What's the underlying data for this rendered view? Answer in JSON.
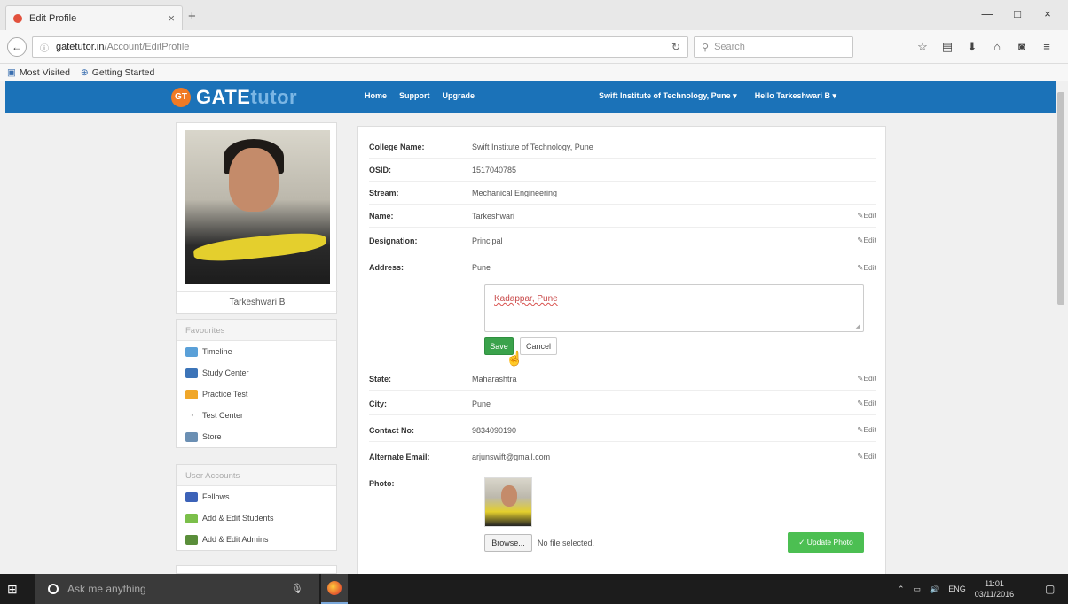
{
  "browser": {
    "tab_title": "Edit Profile",
    "tab_close": "×",
    "new_tab": "+",
    "win_minimize": "—",
    "win_restore": "□",
    "win_close": "×",
    "back": "←",
    "url_host": "gatetutor.in",
    "url_path": "/Account/EditProfile",
    "search_placeholder": "Search",
    "bookmark_1": "Most Visited",
    "bookmark_2": "Getting Started",
    "toolbar_icons": [
      "star-icon",
      "reading-list-icon",
      "download-icon",
      "home-icon",
      "pocket-icon",
      "menu-icon"
    ]
  },
  "site": {
    "logo_badge": "GT",
    "logo_text_1": "GATE",
    "logo_text_2": "tutor",
    "nav": [
      "Home",
      "Support",
      "Upgrade"
    ],
    "college_menu": "Swift Institute of Technology, Pune ▾",
    "user_menu": "Hello Tarkeshwari B ▾",
    "brand_color": "#1b72b8"
  },
  "sidebar": {
    "profile_name": "Tarkeshwari B",
    "favourites_title": "Favourites",
    "favourites": [
      "Timeline",
      "Study Center",
      "Practice Test",
      "Test Center",
      "Store"
    ],
    "accounts_title": "User Accounts",
    "accounts": [
      "Fellows",
      "Add & Edit Students",
      "Add & Edit Admins"
    ]
  },
  "profile": {
    "rows": [
      {
        "label": "College Name:",
        "value": "Swift Institute of Technology, Pune",
        "edit": ""
      },
      {
        "label": "OSID:",
        "value": "1517040785",
        "edit": ""
      },
      {
        "label": "Stream:",
        "value": "Mechanical Engineering",
        "edit": ""
      },
      {
        "label": "Name:",
        "value": "Tarkeshwari",
        "edit": "✎Edit"
      },
      {
        "label": "Designation:",
        "value": "Principal",
        "edit": "✎Edit"
      },
      {
        "label": "Address:",
        "value": "Pune",
        "edit": "✎Edit"
      },
      {
        "label": "State:",
        "value": "Maharashtra",
        "edit": "✎Edit"
      },
      {
        "label": "City:",
        "value": "Pune",
        "edit": "✎Edit"
      },
      {
        "label": "Contact No:",
        "value": "9834090190",
        "edit": "✎Edit"
      },
      {
        "label": "Alternate Email:",
        "value": "arjunswift@gmail.com",
        "edit": "✎Edit"
      },
      {
        "label": "Photo:",
        "value": "",
        "edit": ""
      }
    ],
    "address_input_value": "Kadappar, Pune",
    "save_label": "Save",
    "cancel_label": "Cancel",
    "browse_label": "Browse...",
    "file_status": "No file selected.",
    "update_photo_label": "✓ Update Photo"
  },
  "taskbar": {
    "search_text": "Ask me anything",
    "lang": "ENG",
    "time": "11:01",
    "date": "03/11/2016"
  }
}
